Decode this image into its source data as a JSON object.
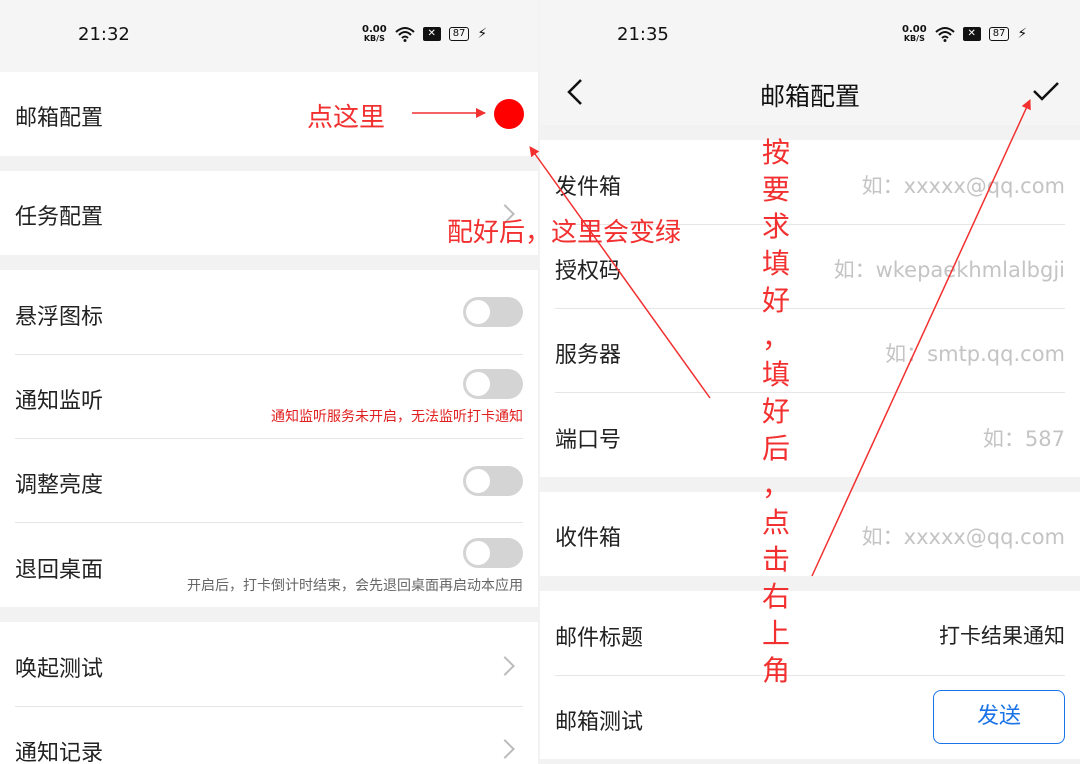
{
  "left": {
    "status": {
      "time": "21:32",
      "speed_value": "0.00",
      "speed_unit": "KB/S",
      "battery": "87"
    },
    "items": {
      "mail_config": "邮箱配置",
      "task_config": "任务配置",
      "float_icon": "悬浮图标",
      "notif_listen": "通知监听",
      "notif_listen_hint": "通知监听服务未开启，无法监听打卡通知",
      "brightness": "调整亮度",
      "back_desktop": "退回桌面",
      "back_desktop_hint": "开启后，打卡倒计时结束，会先退回桌面再启动本应用",
      "wake_test": "唤起测试",
      "notif_records": "通知记录"
    },
    "toggles": {
      "float_icon": false,
      "notif_listen": false,
      "brightness": false,
      "back_desktop": false
    },
    "annotations": {
      "click_here": "点这里",
      "turn_green": "配好后，这里会变绿"
    }
  },
  "right": {
    "status": {
      "time": "21:35",
      "speed_value": "0.00",
      "speed_unit": "KB/S",
      "battery": "87"
    },
    "nav": {
      "title": "邮箱配置",
      "back_icon": "chevron-left-icon",
      "confirm_icon": "checkmark-icon"
    },
    "fields": {
      "sender_label": "发件箱",
      "sender_placeholder": "如：xxxxx@qq.com",
      "auth_label": "授权码",
      "auth_placeholder": "如：wkepaekhmlalbgji",
      "server_label": "服务器",
      "server_placeholder": "如：smtp.qq.com",
      "port_label": "端口号",
      "port_placeholder": "如：587",
      "receiver_label": "收件箱",
      "receiver_placeholder": "如：xxxxx@qq.com",
      "subject_label": "邮件标题",
      "subject_value": "打卡结果通知",
      "test_label": "邮箱测试",
      "send_button": "发送"
    },
    "annotation_chars": [
      "按",
      "要",
      "求",
      "填",
      "好",
      "，",
      "填",
      "好",
      "后",
      "，",
      "点",
      "击",
      "右",
      "上",
      "角"
    ]
  },
  "colors": {
    "annotation_red": "#f23030",
    "dot_red": "#ff0000",
    "accent_blue": "#1a73e8"
  }
}
